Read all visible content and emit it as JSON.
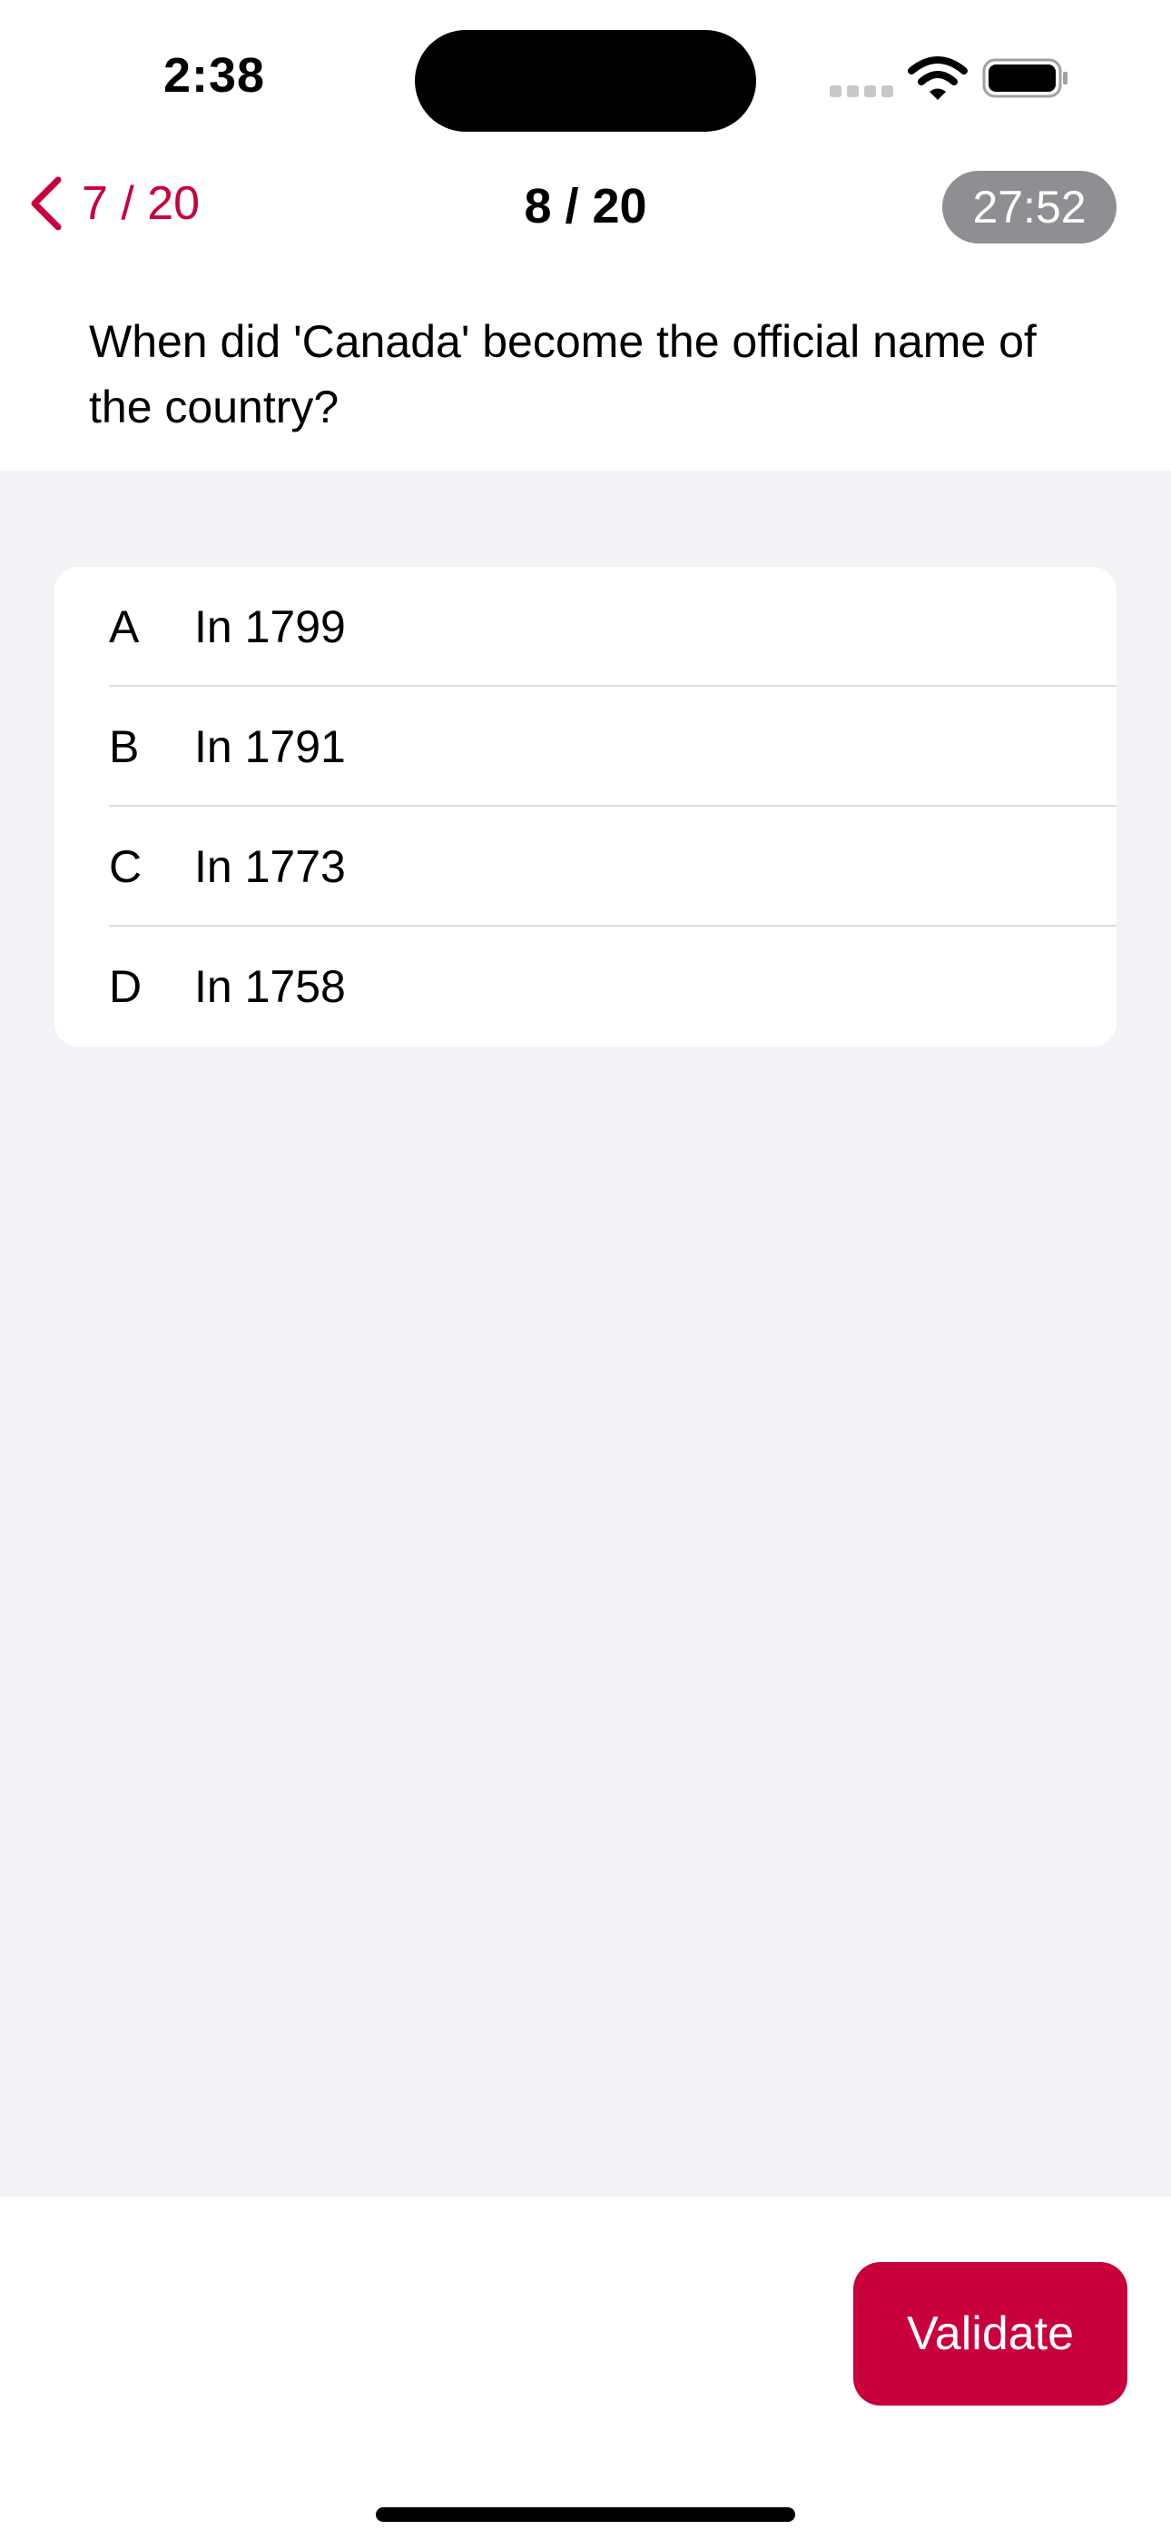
{
  "status_bar": {
    "time": "2:38",
    "icons": [
      "signal-icon",
      "wifi-icon",
      "battery-icon"
    ]
  },
  "nav": {
    "back_label": "7 / 20",
    "back_icon": "chevron-left-icon",
    "title": "8 / 20",
    "timer": "27:52"
  },
  "question": {
    "text": "When did 'Canada' become the official name of the country?"
  },
  "answers": [
    {
      "letter": "A",
      "text": "In 1799"
    },
    {
      "letter": "B",
      "text": "In 1791"
    },
    {
      "letter": "C",
      "text": "In 1773"
    },
    {
      "letter": "D",
      "text": "In 1758"
    }
  ],
  "footer": {
    "validate_label": "Validate"
  },
  "colors": {
    "accent": "#c8003c",
    "timer_background": "#8e8e93",
    "page_background": "#f2f2f7"
  }
}
